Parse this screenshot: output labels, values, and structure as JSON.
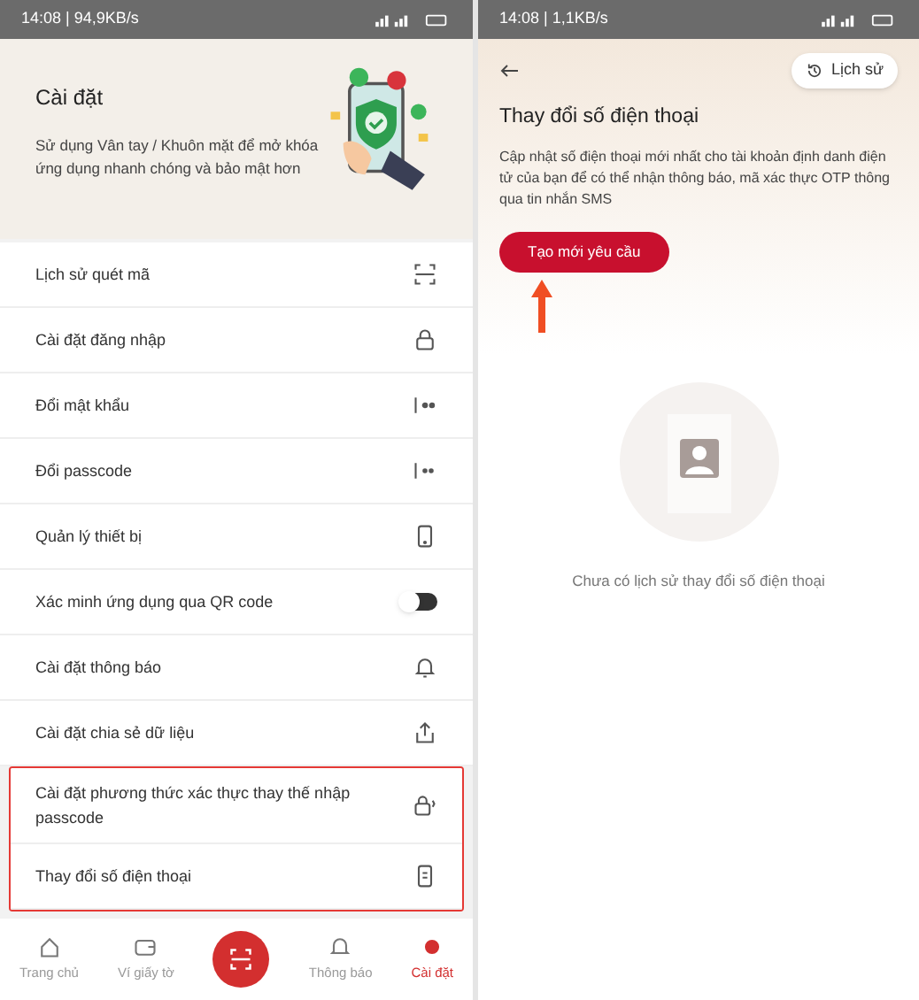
{
  "left": {
    "status_bar": {
      "text": "14:08 | 94,9KB/s"
    },
    "header": {
      "title": "Cài đặt",
      "description": "Sử dụng Vân tay / Khuôn mặt để mở khóa ứng dụng nhanh chóng và bảo mật hơn"
    },
    "items": [
      {
        "label": "Lịch sử quét mã",
        "kind": "link",
        "highlighted": false
      },
      {
        "label": "Cài đặt đăng nhập",
        "kind": "link",
        "highlighted": false
      },
      {
        "label": "Đổi mật khẩu",
        "kind": "link",
        "highlighted": false
      },
      {
        "label": "Đổi passcode",
        "kind": "link",
        "highlighted": false
      },
      {
        "label": "Quản lý thiết bị",
        "kind": "link",
        "highlighted": false
      },
      {
        "label": "Xác minh ứng dụng qua QR code",
        "kind": "toggle",
        "on": false,
        "highlighted": false
      },
      {
        "label": "Cài đặt thông báo",
        "kind": "link",
        "highlighted": false
      },
      {
        "label": "Cài đặt chia sẻ dữ liệu",
        "kind": "link",
        "highlighted": false
      },
      {
        "label": "Cài đặt phương thức xác thực thay thế nhập passcode",
        "kind": "link",
        "highlighted": true
      },
      {
        "label": "Thay đổi số điện thoại",
        "kind": "link",
        "highlighted": true
      }
    ],
    "nav": [
      {
        "label": "Trang chủ",
        "selected": false
      },
      {
        "label": "Ví giấy tờ",
        "selected": false
      },
      {
        "kind": "scan"
      },
      {
        "label": "Thông báo",
        "selected": false
      },
      {
        "label": "Cài đặt",
        "selected": true
      }
    ]
  },
  "right": {
    "status_bar": {
      "text": "14:08 | 1,1KB/s"
    },
    "history_button": "Lịch sử",
    "title": "Thay đổi số điện thoại",
    "description": "Cập nhật số điện thoại mới nhất cho tài khoản định danh điện tử của bạn để có thể nhận thông báo, mã xác thực OTP thông qua tin nhắn SMS",
    "primary_button": "Tạo mới yêu cầu",
    "empty_text": "Chưa có lịch sử thay đổi số điện thoại"
  }
}
